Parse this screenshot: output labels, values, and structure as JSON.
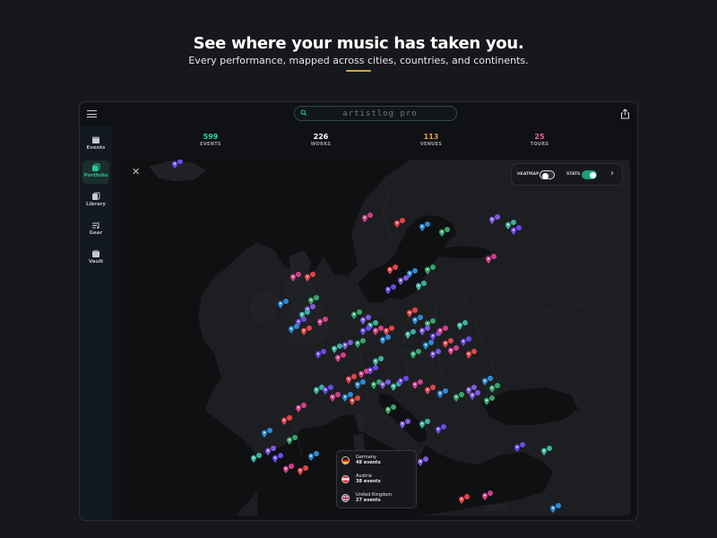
{
  "hero": {
    "title": "See where your music has taken you.",
    "subtitle": "Every performance, mapped across cities, countries, and continents.",
    "accent_color": "#caa44a"
  },
  "app": {
    "search": {
      "placeholder": "artistlog pro",
      "icon": "search-icon"
    },
    "menu_icon": "hamburger-icon",
    "share_icon": "share-icon"
  },
  "sidebar": {
    "items": [
      {
        "label": "Events",
        "icon": "events-icon",
        "active": false
      },
      {
        "label": "Portfolio",
        "icon": "portfolio-icon",
        "active": true
      },
      {
        "label": "Library",
        "icon": "library-icon",
        "active": false
      },
      {
        "label": "Gear",
        "icon": "gear-icon",
        "active": false
      },
      {
        "label": "Vault",
        "icon": "vault-icon",
        "active": false
      }
    ],
    "accent": "#27c29b"
  },
  "stats": [
    {
      "value": "599",
      "label": "EVENTS",
      "color": "#2bd3a2"
    },
    {
      "value": "226",
      "label": "WORKS",
      "color": "#ffffff"
    },
    {
      "value": "113",
      "label": "VENUES",
      "color": "#e0a43a"
    },
    {
      "value": "25",
      "label": "TOURS",
      "color": "#e46a8a"
    }
  ],
  "map": {
    "close_label": "✕",
    "controls": {
      "heatmap_label": "HEATMAP",
      "heatmap_on": false,
      "stats_label": "STATS",
      "stats_on": true,
      "arrow": "›"
    },
    "legend": [
      {
        "country": "Germany",
        "events": "48 events",
        "flag": "germany"
      },
      {
        "country": "Austria",
        "events": "38 events",
        "flag": "austria"
      },
      {
        "country": "United Kingdom",
        "events": "27 events",
        "flag": "uk"
      }
    ],
    "pin_colors": [
      "#6a4be8",
      "#d0408a",
      "#e0464a",
      "#2d8bd6",
      "#37a66a",
      "#7f5ae0",
      "#3db0a0"
    ]
  }
}
